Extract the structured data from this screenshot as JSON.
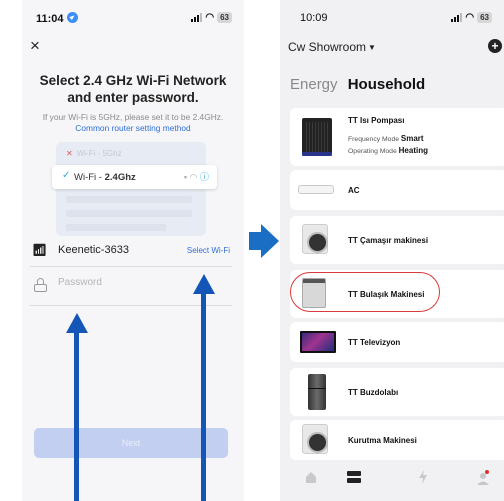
{
  "left_screen": {
    "status_time": "11:04",
    "battery": "63",
    "close_glyph": "×",
    "title": "Select 2.4 GHz Wi-Fi Network and enter password.",
    "subtitle": "If your Wi-Fi is 5GHz, please set it to be 2.4GHz.",
    "subtitle_link": "Common router setting method",
    "illustration": {
      "row_5ghz_prefix": "Wi-Fi - ",
      "row_5ghz_band": "5Ghz",
      "row_24ghz_prefix": "Wi-Fi - ",
      "row_24ghz_band": "2.4Ghz"
    },
    "wifi_network_name": "Keenetic-3633",
    "select_wifi_label": "Select Wi-Fi",
    "password_placeholder": "Password",
    "password_value": "",
    "next_label": "Next"
  },
  "right_screen": {
    "status_time": "10:09",
    "battery": "63",
    "home_name": "Cw Showroom",
    "tab_energy": "Energy",
    "tab_household": "Household",
    "devices": [
      {
        "name": "TT Isı Pompası",
        "line1_label": "Frequency Mode",
        "line1_value": "Smart",
        "line2_label": "Operating Mode",
        "line2_value": "Heating",
        "icon": "heat-pump-icon"
      },
      {
        "name": "AC",
        "icon": "air-conditioner-icon"
      },
      {
        "name": "TT Çamaşır makinesi",
        "icon": "washing-machine-icon"
      },
      {
        "name": "TT Bulaşık Makinesi",
        "icon": "dishwasher-icon",
        "highlighted": true
      },
      {
        "name": "TT Televizyon",
        "icon": "television-icon"
      },
      {
        "name": "TT Buzdolabı",
        "icon": "refrigerator-icon"
      },
      {
        "name": "Kurutma Makinesi",
        "icon": "dryer-icon"
      }
    ],
    "nav": [
      "home-icon",
      "devices-icon",
      "energy-icon",
      "profile-icon"
    ]
  },
  "colors": {
    "accent_blue": "#2f6fd8",
    "annotation_blue": "#1456b8",
    "highlight_red": "#d93a3a",
    "next_button_disabled": "#c3cff0"
  }
}
